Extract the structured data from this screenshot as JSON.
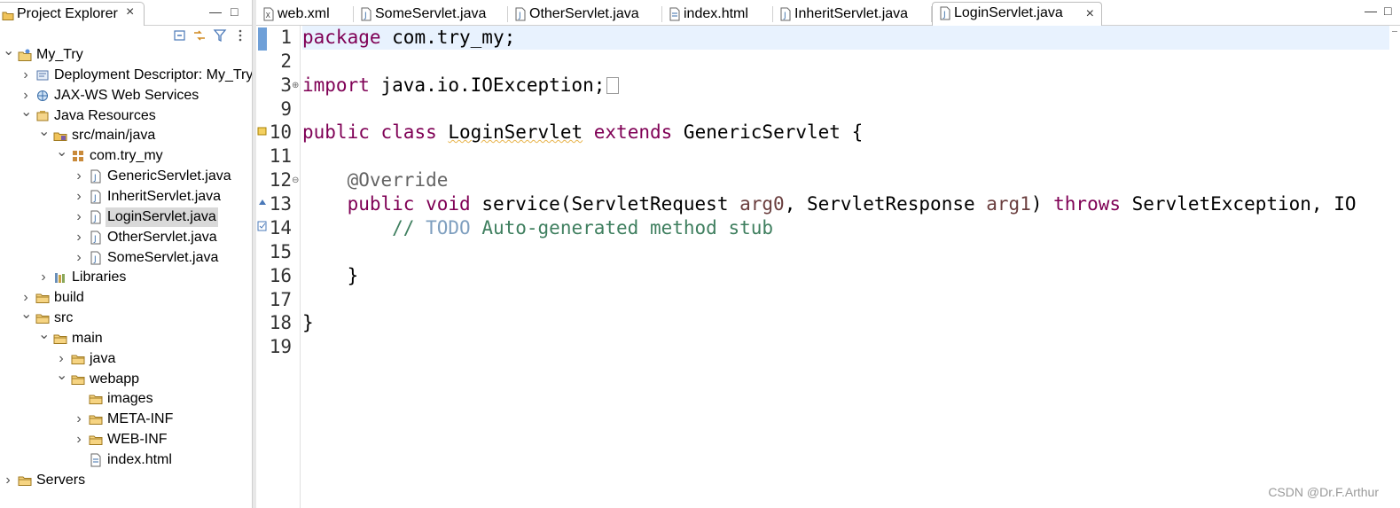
{
  "explorer": {
    "title": "Project Explorer",
    "close": "×",
    "minimize": "—",
    "maximize": "□",
    "tree": [
      {
        "label": "My_Try",
        "depth": 0,
        "expanded": true,
        "icon": "project-icon"
      },
      {
        "label": "Deployment Descriptor: My_Try",
        "depth": 1,
        "expanded": false,
        "icon": "deployment-descriptor-icon"
      },
      {
        "label": "JAX-WS Web Services",
        "depth": 1,
        "expanded": false,
        "icon": "web-services-icon"
      },
      {
        "label": "Java Resources",
        "depth": 1,
        "expanded": true,
        "icon": "java-resources-icon"
      },
      {
        "label": "src/main/java",
        "depth": 2,
        "expanded": true,
        "icon": "source-folder-icon"
      },
      {
        "label": "com.try_my",
        "depth": 3,
        "expanded": true,
        "icon": "package-icon"
      },
      {
        "label": "GenericServlet.java",
        "depth": 4,
        "expanded": false,
        "icon": "java-file-icon"
      },
      {
        "label": "InheritServlet.java",
        "depth": 4,
        "expanded": false,
        "icon": "java-file-icon"
      },
      {
        "label": "LoginServlet.java",
        "depth": 4,
        "expanded": false,
        "icon": "java-file-icon",
        "selected": true
      },
      {
        "label": "OtherServlet.java",
        "depth": 4,
        "expanded": false,
        "icon": "java-file-icon"
      },
      {
        "label": "SomeServlet.java",
        "depth": 4,
        "expanded": false,
        "icon": "java-file-icon"
      },
      {
        "label": "Libraries",
        "depth": 2,
        "expanded": false,
        "icon": "libraries-icon"
      },
      {
        "label": "build",
        "depth": 1,
        "expanded": false,
        "icon": "folder-icon"
      },
      {
        "label": "src",
        "depth": 1,
        "expanded": true,
        "icon": "folder-icon"
      },
      {
        "label": "main",
        "depth": 2,
        "expanded": true,
        "icon": "folder-icon"
      },
      {
        "label": "java",
        "depth": 3,
        "expanded": false,
        "icon": "folder-icon"
      },
      {
        "label": "webapp",
        "depth": 3,
        "expanded": true,
        "icon": "folder-icon"
      },
      {
        "label": "images",
        "depth": 4,
        "expanded": null,
        "icon": "folder-icon"
      },
      {
        "label": "META-INF",
        "depth": 4,
        "expanded": false,
        "icon": "folder-icon"
      },
      {
        "label": "WEB-INF",
        "depth": 4,
        "expanded": false,
        "icon": "folder-icon"
      },
      {
        "label": "index.html",
        "depth": 4,
        "expanded": null,
        "icon": "html-file-icon"
      },
      {
        "label": "Servers",
        "depth": 0,
        "expanded": false,
        "icon": "folder-icon"
      }
    ]
  },
  "editor": {
    "tabs": [
      {
        "label": "web.xml",
        "icon": "xml-file-icon"
      },
      {
        "label": "SomeServlet.java",
        "icon": "java-file-icon"
      },
      {
        "label": "OtherServlet.java",
        "icon": "java-file-icon"
      },
      {
        "label": "index.html",
        "icon": "html-file-icon"
      },
      {
        "label": "InheritServlet.java",
        "icon": "java-file-icon"
      },
      {
        "label": "LoginServlet.java",
        "icon": "java-file-icon",
        "active": true
      }
    ],
    "close": "×",
    "minimize": "—",
    "maximize": "□",
    "line_numbers": [
      "1",
      "2",
      "3",
      "9",
      "10",
      "11",
      "12",
      "13",
      "14",
      "15",
      "16",
      "17",
      "18",
      "19"
    ],
    "code": {
      "l1_kw": "package",
      "l1_rest": " com.try_my;",
      "l3_kw": "import",
      "l3_rest": " java.io.IOException;",
      "l10_kw1": "public",
      "l10_kw2": "class",
      "l10_name": "LoginServlet",
      "l10_kw3": "extends",
      "l10_rest": " GenericServlet {",
      "l12_ann": "@Override",
      "l13_kw1": "public",
      "l13_kw2": "void",
      "l13_a": " service(ServletRequest ",
      "l13_p1": "arg0",
      "l13_b": ", ServletResponse ",
      "l13_p2": "arg1",
      "l13_c": ") ",
      "l13_kw3": "throws",
      "l13_d": " ServletException, IO",
      "l14_c1": "// ",
      "l14_todo": "TODO",
      "l14_c2": " Auto-generated method stub",
      "l16": "}",
      "l18": "}"
    }
  },
  "watermark": "CSDN @Dr.F.Arthur"
}
